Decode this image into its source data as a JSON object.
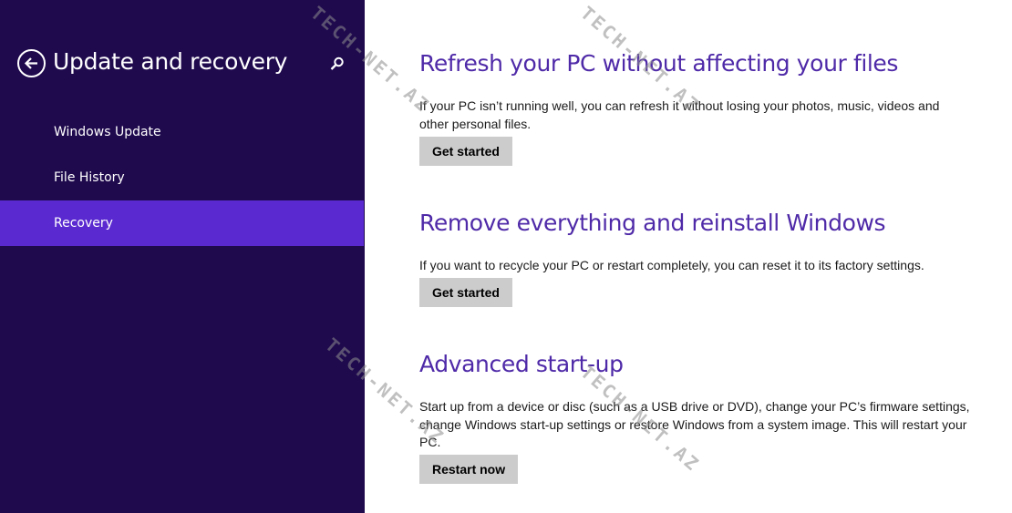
{
  "sidebar": {
    "title": "Update and recovery",
    "back_icon": "back-arrow-icon",
    "search_icon": "search-icon",
    "items": [
      {
        "label": "Windows Update",
        "selected": false
      },
      {
        "label": "File History",
        "selected": false
      },
      {
        "label": "Recovery",
        "selected": true
      }
    ]
  },
  "sections": [
    {
      "heading": "Refresh your PC without affecting your files",
      "description": "If your PC isn’t running well, you can refresh it without losing your photos, music, videos and other personal files.",
      "button": "Get started"
    },
    {
      "heading": "Remove everything and reinstall Windows",
      "description": "If you want to recycle your PC or restart completely, you can reset it to its factory settings.",
      "button": "Get started"
    },
    {
      "heading": "Advanced start-up",
      "description": "Start up from a device or disc (such as a USB drive or DVD), change your PC’s firmware settings, change Windows start-up settings or restore Windows from a system image. This will restart your PC.",
      "button": "Restart now"
    }
  ],
  "watermark": "TECH-NET.AZ",
  "colors": {
    "sidebar_bg": "#1f0a4e",
    "selected_bg": "#5a2ad0",
    "heading": "#4f2aa8",
    "button_bg": "#cccccc"
  }
}
